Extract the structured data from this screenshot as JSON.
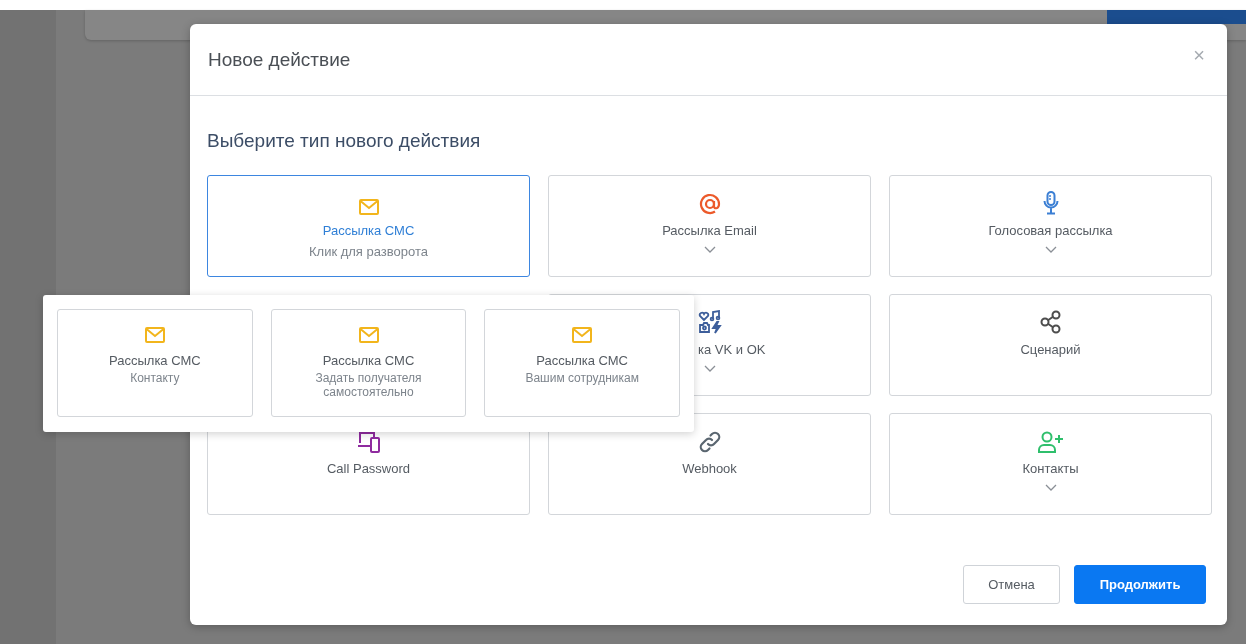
{
  "dialog": {
    "title": "Новое действие",
    "close": "×",
    "heading": "Выберите тип нового действия",
    "cards": [
      {
        "kind": "sms",
        "label": "Рассылка СМС",
        "hint": "Клик для разворота",
        "selected": true,
        "expandable": false
      },
      {
        "kind": "email",
        "label": "Рассылка Email",
        "selected": false,
        "expandable": true
      },
      {
        "kind": "voice",
        "label": "Голосовая рассылка",
        "selected": false,
        "expandable": true
      },
      {
        "kind": "social",
        "label": "ка VK и OK",
        "selected": false,
        "expandable": true
      },
      {
        "kind": "scenario",
        "label": "Сценарий",
        "selected": false,
        "expandable": false
      },
      {
        "kind": "callpassword",
        "label": "Call Password",
        "selected": false,
        "expandable": false
      },
      {
        "kind": "webhook",
        "label": "Webhook",
        "selected": false,
        "expandable": false
      },
      {
        "kind": "contacts",
        "label": "Контакты",
        "selected": false,
        "expandable": true
      }
    ],
    "submenu": [
      {
        "title": "Рассылка СМС",
        "subtitle": "Контакту"
      },
      {
        "title": "Рассылка СМС",
        "subtitle": "Задать получателя самостоятельно"
      },
      {
        "title": "Рассылка СМС",
        "subtitle": "Вашим сотрудникам"
      }
    ],
    "buttons": [
      {
        "kind": "secondary",
        "label": "Отмена"
      },
      {
        "kind": "primary",
        "label": "Продолжить"
      }
    ]
  }
}
